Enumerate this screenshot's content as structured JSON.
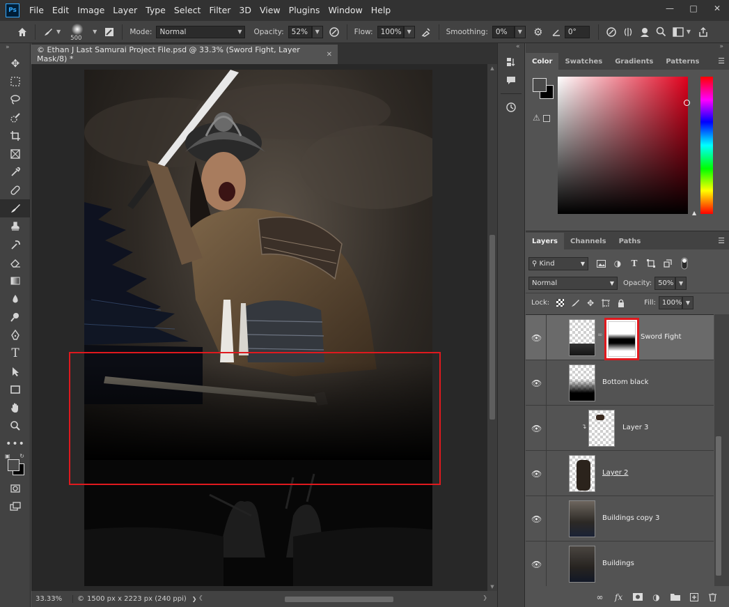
{
  "app": {
    "logo": "Ps",
    "menu": [
      "File",
      "Edit",
      "Image",
      "Layer",
      "Type",
      "Select",
      "Filter",
      "3D",
      "View",
      "Plugins",
      "Window",
      "Help"
    ]
  },
  "options": {
    "brush_size": "500",
    "mode_label": "Mode:",
    "mode_value": "Normal",
    "opacity_label": "Opacity:",
    "opacity_value": "52%",
    "flow_label": "Flow:",
    "flow_value": "100%",
    "smoothing_label": "Smoothing:",
    "smoothing_value": "0%",
    "angle_value": "0°"
  },
  "document": {
    "tab_title": "© Ethan J Last Samurai Project File.psd @ 33.3% (Sword Fight, Layer Mask/8) *",
    "zoom": "33.33%",
    "info": "1500 px x 2223 px (240 ppi)"
  },
  "color_panel": {
    "tabs": [
      "Color",
      "Swatches",
      "Gradients",
      "Patterns"
    ],
    "active_tab": "Color",
    "foreground": "#4a4a4a",
    "background": "#000000"
  },
  "layers_panel": {
    "tabs": [
      "Layers",
      "Channels",
      "Paths"
    ],
    "filter_label": "Kind",
    "blend_mode": "Normal",
    "opacity_label": "Opacity:",
    "opacity_value": "50%",
    "lock_label": "Lock:",
    "fill_label": "Fill:",
    "fill_value": "100%",
    "layers": [
      {
        "name": "Sword Fight",
        "selected": true
      },
      {
        "name": "Bottom black",
        "selected": false
      },
      {
        "name": "Layer 3",
        "selected": false
      },
      {
        "name": "Layer 2",
        "selected": false
      },
      {
        "name": "Buildings  copy 3",
        "selected": false
      },
      {
        "name": "Buildings",
        "selected": false
      }
    ]
  }
}
